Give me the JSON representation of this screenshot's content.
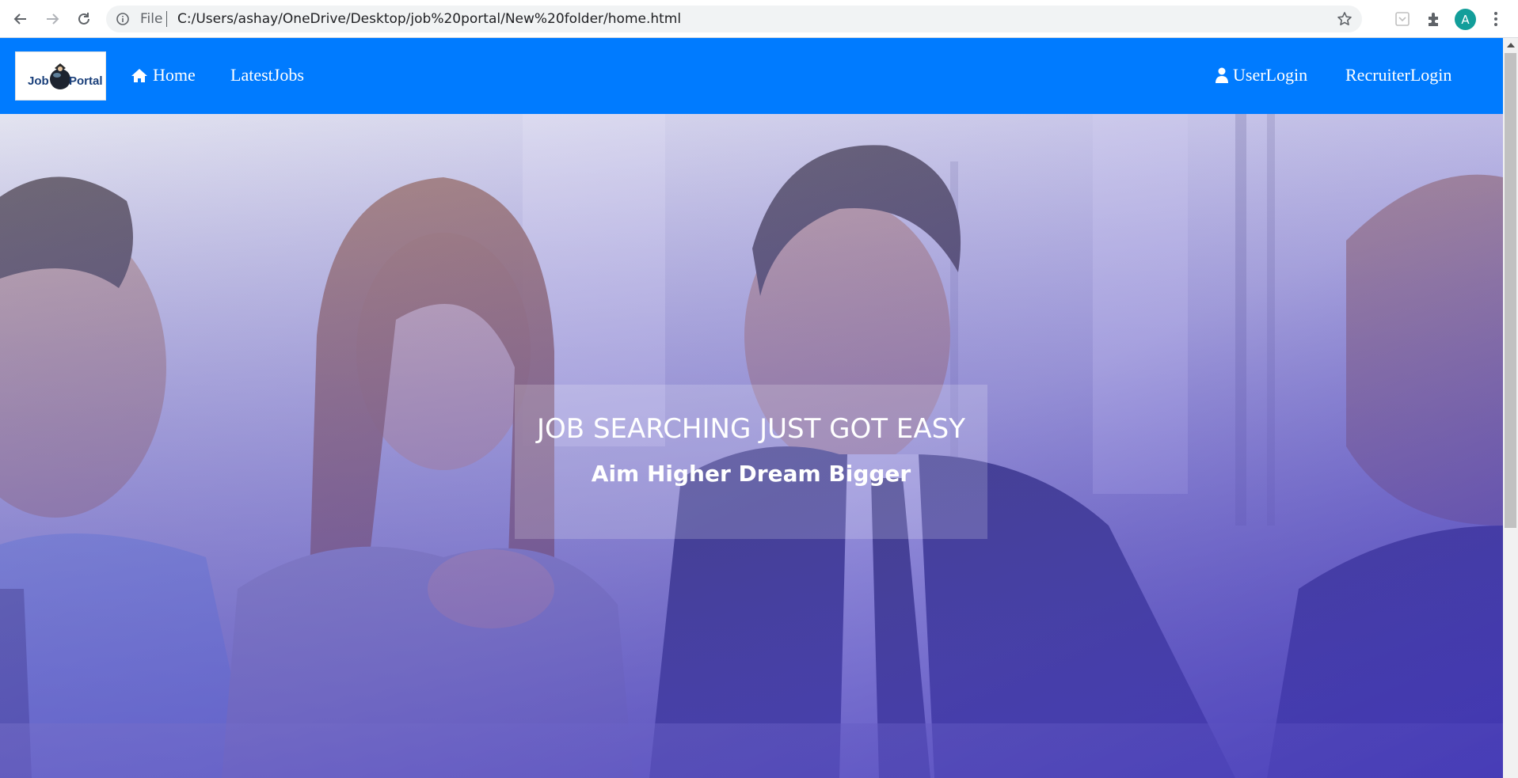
{
  "browser": {
    "scheme_label": "File",
    "url": "C:/Users/ashay/OneDrive/Desktop/job%20portal/New%20folder/home.html",
    "profile_initial": "A",
    "icons": [
      "back-arrow-icon",
      "forward-arrow-icon",
      "reload-icon",
      "info-icon",
      "star-icon",
      "extension-icon",
      "puzzle-icon",
      "more-vert-icon"
    ]
  },
  "navbar": {
    "logo": {
      "word1": "Job",
      "word2": "Portal"
    },
    "left_links": [
      {
        "label": "Home",
        "icon": "home-icon"
      },
      {
        "label": "LatestJobs"
      }
    ],
    "right_links": [
      {
        "label": "UserLogin",
        "icon": "user-icon"
      },
      {
        "label": "RecruiterLogin"
      }
    ],
    "background_color": "#007bff"
  },
  "hero": {
    "title": "JOB SEARCHING JUST GOT EASY",
    "subtitle": "Aim Higher Dream Bigger",
    "overlay_colors": [
      "#dcdcf0",
      "#3b2fb0"
    ]
  }
}
